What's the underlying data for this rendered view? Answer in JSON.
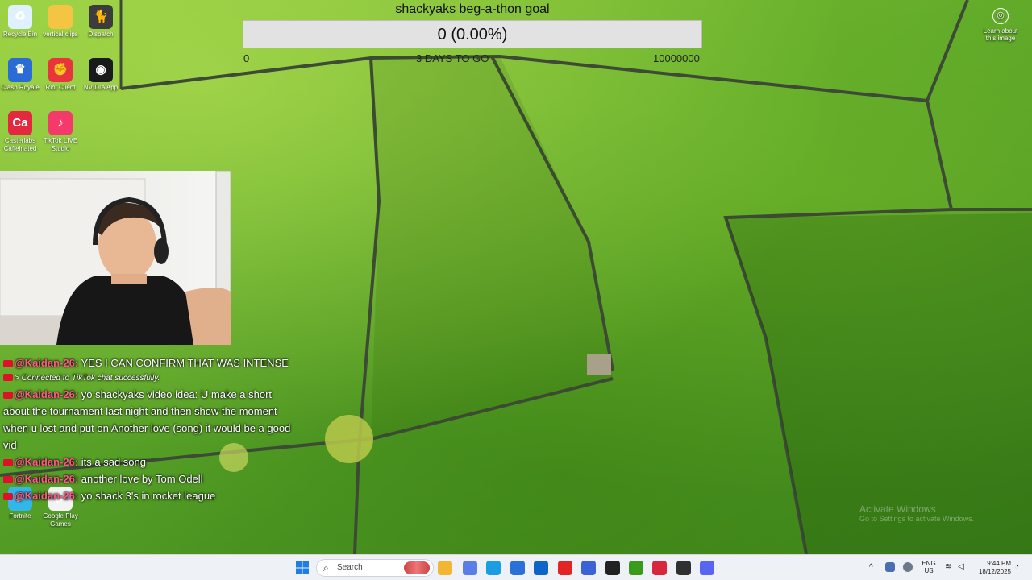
{
  "desktop_icons": [
    {
      "label": "Recycle Bin",
      "icon": "recycle-bin-icon",
      "color": "#dff1ff",
      "glyph": "♻"
    },
    {
      "label": "vertical clips",
      "icon": "folder-icon",
      "color": "#f4c542",
      "glyph": ""
    },
    {
      "label": "Dispatch",
      "icon": "dispatch-icon",
      "color": "#3c3c3c",
      "glyph": "🐈"
    },
    {
      "label": "Clash Royale",
      "icon": "clash-royale-icon",
      "color": "#2a6bd6",
      "glyph": "♛"
    },
    {
      "label": "Riot Client",
      "icon": "riot-client-icon",
      "color": "#e8343c",
      "glyph": "✊"
    },
    {
      "label": "NVIDIA App",
      "icon": "nvidia-icon",
      "color": "#1a1a1a",
      "glyph": "◉"
    },
    {
      "label": "Casterlabs Caffeinated",
      "icon": "casterlabs-icon",
      "color": "#e3283f",
      "glyph": "Ca"
    },
    {
      "label": "TikTok LIVE Studio",
      "icon": "tiktok-icon",
      "color": "#f33a6a",
      "glyph": "♪"
    },
    {
      "label": "Fortnite",
      "icon": "fortnite-icon",
      "color": "#33b7e8",
      "glyph": "F"
    },
    {
      "label": "Google Play Games",
      "icon": "google-play-games-icon",
      "color": "#f3f3f3",
      "glyph": "▶"
    }
  ],
  "goal": {
    "title": "shackyaks beg-a-thon goal",
    "value_text": "0 (0.00%)",
    "progress": 0,
    "min_label": "0",
    "days_label": "3 DAYS TO GO",
    "max_label": "10000000"
  },
  "chat": [
    {
      "type": "msg",
      "user": "@Kaidan-26:",
      "text": "YES I CAN CONFIRM THAT WAS INTENSE"
    },
    {
      "type": "system",
      "text": "> Connected to TikTok chat successfully."
    },
    {
      "type": "msg",
      "user": "@Kaidan-26:",
      "text": "yo shackyaks video idea: U make a short about the tournament last night and then show the moment when u lost and put on Another love (song) it would be a good vid"
    },
    {
      "type": "msg",
      "user": "@Kaidan-26:",
      "text": "its a sad song"
    },
    {
      "type": "msg",
      "user": "@Kaidan-26:",
      "text": "another love by Tom Odell"
    },
    {
      "type": "msg",
      "user": "@Kaidan-26:",
      "text": "yo shack 3's in rocket league"
    }
  ],
  "learn_image": {
    "label": "Learn about this image",
    "icon": "image-info-icon"
  },
  "activate": {
    "title": "Activate Windows",
    "subtitle": "Go to Settings to activate Windows."
  },
  "taskbar": {
    "search_placeholder": "Search",
    "apps": [
      {
        "name": "file-explorer-icon",
        "color": "#f2b632"
      },
      {
        "name": "copilot-icon",
        "color": "#5a7dea"
      },
      {
        "name": "edge-icon",
        "color": "#1b9de2"
      },
      {
        "name": "store-icon",
        "color": "#2b6fd8"
      },
      {
        "name": "outlook-icon",
        "color": "#0f64c8"
      },
      {
        "name": "youtube-icon",
        "color": "#e32424"
      },
      {
        "name": "app-icon",
        "color": "#3b63d6"
      },
      {
        "name": "capcut-icon",
        "color": "#222222"
      },
      {
        "name": "nvidia-icon",
        "color": "#3a9a1a"
      },
      {
        "name": "casterlabs-icon",
        "color": "#d8263b"
      },
      {
        "name": "obs-icon",
        "color": "#303030"
      },
      {
        "name": "discord-icon",
        "color": "#5865f2"
      }
    ],
    "lang_top": "ENG",
    "lang_bottom": "US",
    "time": "9:44 PM",
    "date": "18/12/2025"
  }
}
